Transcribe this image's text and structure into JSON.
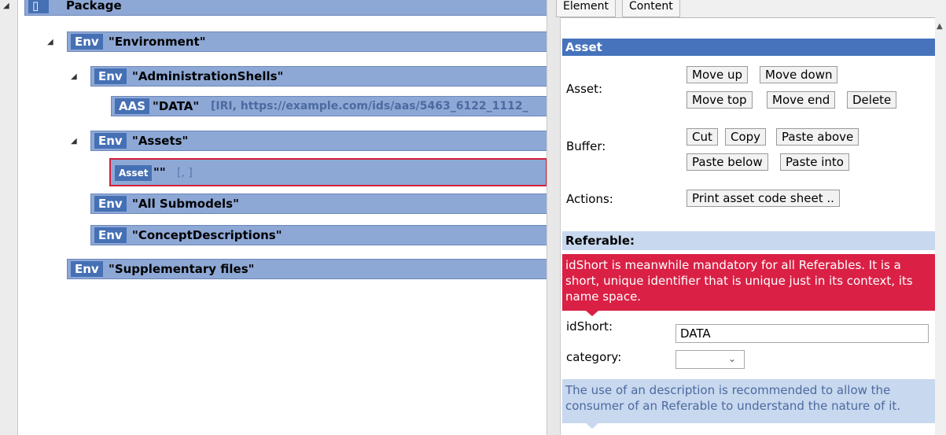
{
  "tree": {
    "package_label": "Package",
    "nodes": [
      {
        "tag": "Env",
        "label": "\"Environment\"",
        "info": ""
      },
      {
        "tag": "Env",
        "label": "\"AdministrationShells\"",
        "info": ""
      },
      {
        "tag": "AAS",
        "label": "\"DATA\"",
        "info": "[IRI, https://example.com/ids/aas/5463_6122_1112_"
      },
      {
        "tag": "Env",
        "label": "\"Assets\"",
        "info": ""
      },
      {
        "tag": "Asset",
        "label": "\"\"",
        "info": "[, ]"
      },
      {
        "tag": "Env",
        "label": "\"All Submodels\"",
        "info": ""
      },
      {
        "tag": "Env",
        "label": "\"ConceptDescriptions\"",
        "info": ""
      },
      {
        "tag": "Env",
        "label": "\"Supplementary files\"",
        "info": ""
      }
    ]
  },
  "tabs": [
    "Element",
    "Content"
  ],
  "asset_section": {
    "title": "Asset",
    "asset_label": "Asset:",
    "asset_buttons": [
      "Move up",
      "Move down",
      "Move top",
      "Move end",
      "Delete"
    ],
    "buffer_label": "Buffer:",
    "buffer_buttons": [
      "Cut",
      "Copy",
      "Paste above",
      "Paste below",
      "Paste into"
    ],
    "actions_label": "Actions:",
    "actions_button": "Print asset code sheet .."
  },
  "referable": {
    "title": "Referable:",
    "idshort_hint": "idShort is meanwhile mandatory for all Referables. It is a short, unique identifier that is unique just in its context, its name space.",
    "idshort_label": "idShort:",
    "idshort_value": "DATA",
    "category_label": "category:",
    "category_value": "",
    "description_hint": "The use of an description is recommended to allow the consumer of an Referable to understand the nature of it."
  },
  "colors": {
    "row_bg": "#8ea8d6",
    "tag_bg": "#4670b4",
    "selected_border": "#d2203c",
    "section_blue": "#4673bc",
    "hint_red": "#da2045",
    "hint_blue": "#c8d8ee"
  }
}
